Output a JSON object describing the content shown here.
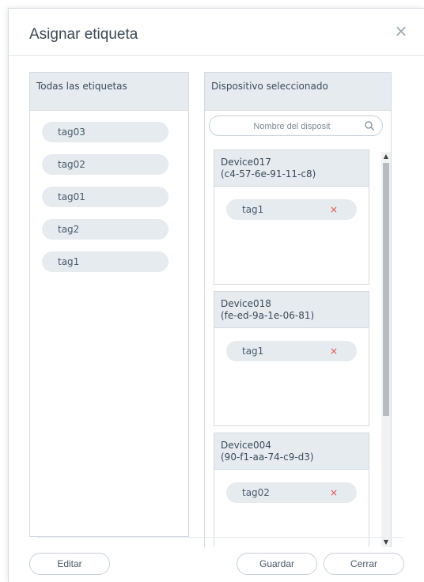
{
  "dialog": {
    "title": "Asignar etiqueta",
    "close_symbol": "×"
  },
  "left_panel": {
    "header": "Todas las etiquetas",
    "tags": [
      "tag03",
      "tag02",
      "tag01",
      "tag2",
      "tag1"
    ]
  },
  "right_panel": {
    "header": "Dispositivo seleccionado",
    "search": {
      "placeholder": "Nombre del disposit",
      "value": "",
      "icon": "search-icon"
    },
    "devices": [
      {
        "name": "Device017",
        "mac": "(c4-57-6e-91-11-c8)",
        "tags": [
          "tag1"
        ]
      },
      {
        "name": "Device018",
        "mac": "(fe-ed-9a-1e-06-81)",
        "tags": [
          "tag1"
        ]
      },
      {
        "name": "Device004",
        "mac": "(90-f1-aa-74-c9-d3)",
        "tags": [
          "tag02"
        ]
      }
    ],
    "remove_symbol": "×"
  },
  "footer": {
    "edit_label": "Editar",
    "save_label": "Guardar",
    "close_label": "Cerrar"
  },
  "colors": {
    "panel_header_bg": "#e6ebf0",
    "pill_bg": "#e6ebf0",
    "remove_color": "#e2514a",
    "border": "#d4dae0"
  }
}
